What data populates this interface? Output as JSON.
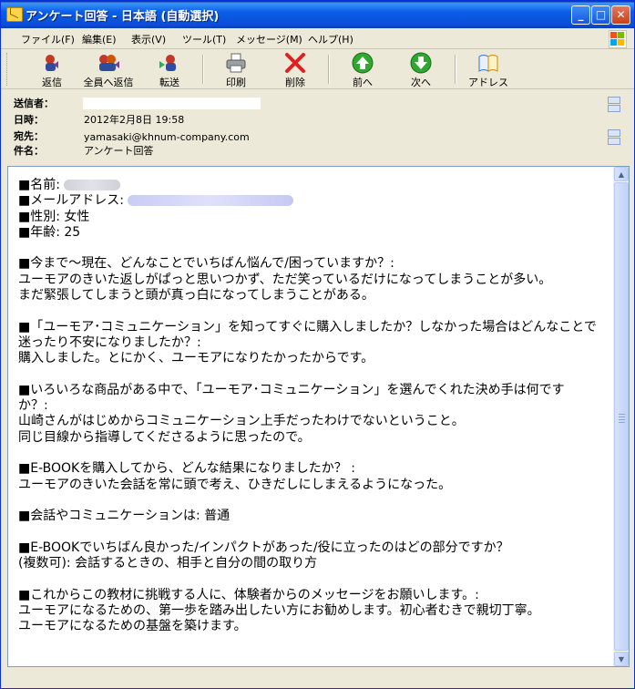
{
  "window": {
    "title": "アンケート回答 - 日本語 (自動選択)",
    "controls": {
      "minimize": "_",
      "maximize": "□",
      "close": "✕"
    }
  },
  "menu": [
    "ファイル(F)",
    "編集(E)",
    "表示(V)",
    "ツール(T)",
    "メッセージ(M)",
    "ヘルプ(H)"
  ],
  "toolbar": [
    {
      "label": "返信",
      "icon": "reply-icon"
    },
    {
      "label": "全員へ返信",
      "icon": "reply-all-icon"
    },
    {
      "label": "転送",
      "icon": "forward-icon"
    },
    {
      "label": "印刷",
      "icon": "printer-icon"
    },
    {
      "label": "削除",
      "icon": "delete-icon"
    },
    {
      "label": "前へ",
      "icon": "previous-icon"
    },
    {
      "label": "次へ",
      "icon": "next-icon"
    },
    {
      "label": "アドレス",
      "icon": "address-book-icon"
    }
  ],
  "header": {
    "from_label": "送信者：",
    "from_value": "",
    "date_label": "日時：",
    "date_value": "2012年2月8日 19:58",
    "to_label": "宛先：",
    "to_value": "yamasaki@khnum-company.com",
    "subject_label": "件名：",
    "subject_value": "アンケート回答"
  },
  "body": {
    "name_label": "■名前:",
    "email_label": "■メールアドレス:",
    "gender_line": "■性別: 女性",
    "age_line": "■年齢: 25",
    "q1": "■今まで～現在、どんなことでいちばん悩んで/困っていますか？:",
    "a1_1": "ユーモアのきいた返しがぱっと思いつかず、ただ笑っているだけになってしまうことが多い。",
    "a1_2": "まだ緊張してしまうと頭が真っ白になってしまうことがある。",
    "q2_1": "■「ユーモア･コミュニケーション」を知ってすぐに購入しましたか？しなかった場合はどんなことで",
    "q2_2": "迷ったり不安になりましたか？:",
    "a2": "購入しました。とにかく、ユーモアになりたかったからです。",
    "q3_1": "■いろいろな商品がある中で、「ユーモア･コミュニケーション」を選んでくれた決め手は何です",
    "q3_2": "か？:",
    "a3_1": "山崎さんがはじめからコミュニケーション上手だったわけでないということ。",
    "a3_2": "同じ目線から指導してくださるように思ったので。",
    "q4": "■E-BOOKを購入してから、どんな結果になりましたか？ :",
    "a4": "ユーモアのきいた会話を常に頭で考え、ひきだしにしまえるようになった。",
    "q5": "■会話やコミュニケーションは: 普通",
    "q6": "■E-BOOKでいちばん良かった/インパクトがあった/役に立ったのはどの部分ですか？",
    "a6": "(複数可): 会話するときの、相手と自分の間の取り方",
    "q7": "■これからこの教材に挑戦する人に、体験者からのメッセージをお願いします。:",
    "a7_1": "ユーモアになるための、第一歩を踏み出したい方にお勧めします。初心者むきで親切丁寧。",
    "a7_2": "ユーモアになるための基盤を築けます。"
  },
  "colors": {
    "titlebar": "#0a4ed6",
    "accent": "#3d95ff",
    "window_bg": "#ece9d8"
  }
}
